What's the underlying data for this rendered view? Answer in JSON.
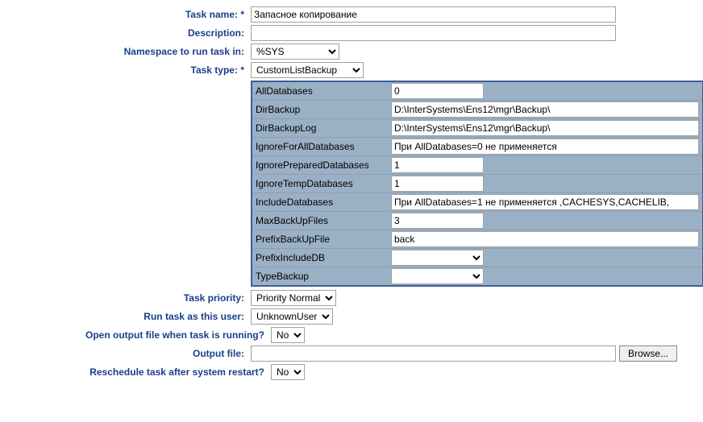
{
  "labels": {
    "task_name": "Task name:",
    "description": "Description:",
    "namespace": "Namespace to run task in:",
    "task_type": "Task type:",
    "task_priority": "Task priority:",
    "run_as_user": "Run task as this user:",
    "open_output": "Open output file when task is running?",
    "output_file": "Output file:",
    "reschedule": "Reschedule task after system restart?",
    "browse": "Browse...",
    "req": " *"
  },
  "values": {
    "task_name": "Запасное копирование",
    "description": "",
    "namespace": "%SYS",
    "task_type": "CustomListBackup",
    "task_priority": "Priority Normal",
    "run_as_user": "UnknownUser",
    "open_output": "No",
    "output_file": "",
    "reschedule": "No"
  },
  "params": {
    "AllDatabases": {
      "label": "AllDatabases",
      "value": "0",
      "narrow": true
    },
    "DirBackup": {
      "label": "DirBackup",
      "value": "D:\\InterSystems\\Ens12\\mgr\\Backup\\"
    },
    "DirBackupLog": {
      "label": "DirBackupLog",
      "value": "D:\\InterSystems\\Ens12\\mgr\\Backup\\"
    },
    "IgnoreForAllDatabases": {
      "label": "IgnoreForAllDatabases",
      "value": "При AllDatabases=0 не применяется"
    },
    "IgnorePreparedDatabases": {
      "label": "IgnorePreparedDatabases",
      "value": "1",
      "narrow": true
    },
    "IgnoreTempDatabases": {
      "label": "IgnoreTempDatabases",
      "value": "1",
      "narrow": true
    },
    "IncludeDatabases": {
      "label": "IncludeDatabases",
      "value": "При AllDatabases=1 не применяется ,CACHESYS,CACHELIB,"
    },
    "MaxBackUpFiles": {
      "label": "MaxBackUpFiles",
      "value": "3",
      "narrow": true
    },
    "PrefixBackUpFile": {
      "label": "PrefixBackUpFile",
      "value": "back"
    },
    "PrefixIncludeDB": {
      "label": "PrefixIncludeDB",
      "value": ""
    },
    "TypeBackup": {
      "label": "TypeBackup",
      "value": ""
    }
  }
}
